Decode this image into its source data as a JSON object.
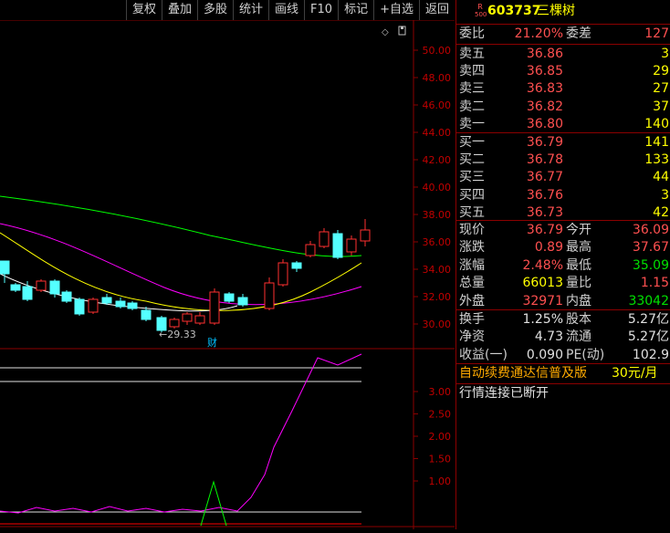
{
  "toolbar": {
    "items": [
      "复权",
      "叠加",
      "多股",
      "统计",
      "画线",
      "F10",
      "标记",
      "+自选",
      "返回"
    ]
  },
  "chart": {
    "price_axis": [
      "50.00",
      "48.00",
      "46.00",
      "44.00",
      "42.00",
      "40.00",
      "38.00",
      "36.00",
      "34.00",
      "32.00",
      "30.00"
    ],
    "indicator_axis": [
      "3.00",
      "2.50",
      "2.00",
      "1.50",
      "1.00"
    ],
    "low_marker": "29.33",
    "event_marker": "财"
  },
  "stock": {
    "badge_top": "R",
    "badge_bottom": "500",
    "code": "603737",
    "name": "三棵树"
  },
  "order": {
    "wb_label": "委比",
    "wb_value": "21.20%",
    "wc_label": "委差",
    "wc_value": "127"
  },
  "asks": [
    {
      "label": "卖五",
      "price": "36.86",
      "vol": "3"
    },
    {
      "label": "卖四",
      "price": "36.85",
      "vol": "29"
    },
    {
      "label": "卖三",
      "price": "36.83",
      "vol": "27"
    },
    {
      "label": "卖二",
      "price": "36.82",
      "vol": "37"
    },
    {
      "label": "卖一",
      "price": "36.80",
      "vol": "140"
    }
  ],
  "bids": [
    {
      "label": "买一",
      "price": "36.79",
      "vol": "141"
    },
    {
      "label": "买二",
      "price": "36.78",
      "vol": "133"
    },
    {
      "label": "买三",
      "price": "36.77",
      "vol": "44"
    },
    {
      "label": "买四",
      "price": "36.76",
      "vol": "3"
    },
    {
      "label": "买五",
      "price": "36.73",
      "vol": "42"
    }
  ],
  "quote": [
    {
      "l1": "现价",
      "v1": "36.79",
      "l2": "今开",
      "v2": "36.09"
    },
    {
      "l1": "涨跌",
      "v1": "0.89",
      "l2": "最高",
      "v2": "37.67"
    },
    {
      "l1": "涨幅",
      "v1": "2.48%",
      "l2": "最低",
      "v2": "35.09"
    },
    {
      "l1": "总量",
      "v1": "66013",
      "l2": "量比",
      "v2": "1.15"
    },
    {
      "l1": "外盘",
      "v1": "32971",
      "l2": "内盘",
      "v2": "33042"
    }
  ],
  "fund": [
    {
      "l1": "换手",
      "v1": "1.25%",
      "l2": "股本",
      "v2": "5.27亿"
    },
    {
      "l1": "净资",
      "v1": "4.73",
      "l2": "流通",
      "v2": "5.27亿"
    },
    {
      "l1": "收益(一)",
      "v1": "0.090",
      "l2": "PE(动)",
      "v2": "102.9"
    }
  ],
  "promo": {
    "text": "自动续费通达信普及版",
    "price": "30元/月"
  },
  "status": {
    "text": "行情连接已断开"
  }
}
